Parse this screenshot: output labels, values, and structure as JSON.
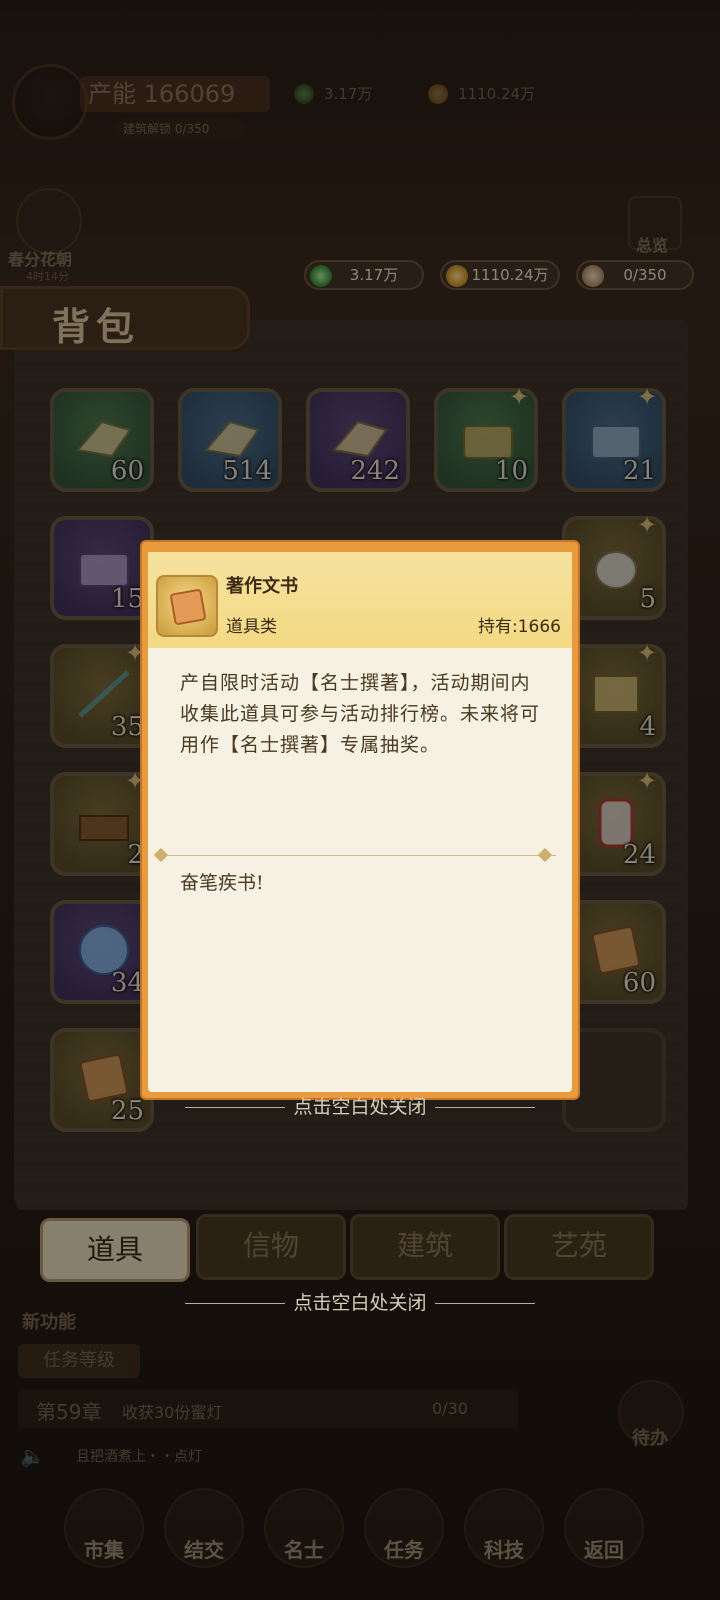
{
  "background_hud": {
    "production_label": "产能",
    "production_value": "166069",
    "production_sub": "建筑解锁 0/350",
    "jade_amount": "3.17万",
    "coin_amount": "1110.24万",
    "left_badge_label": "春分花朝",
    "left_badge_time": "4时14分",
    "right_badge_label": "总览"
  },
  "resources": {
    "jade": "3.17万",
    "coin": "1110.24万",
    "people": "0/350"
  },
  "backpack": {
    "title": "背包",
    "items": [
      {
        "count": "60"
      },
      {
        "count": "514"
      },
      {
        "count": "242"
      },
      {
        "count": "10"
      },
      {
        "count": "21"
      },
      {
        "count": "15"
      },
      {
        "count": "5"
      },
      {
        "count": "35"
      },
      {
        "count": "4"
      },
      {
        "count": "2"
      },
      {
        "count": "24"
      },
      {
        "count": "34"
      },
      {
        "count": "60"
      },
      {
        "count": "25"
      }
    ],
    "tabs": [
      "道具",
      "信物",
      "建筑",
      "艺苑"
    ]
  },
  "lower_hud": {
    "new_feature": "新功能",
    "task_level": "任务等级",
    "chapter": "第59章",
    "chapter_task": "收获30份蜜灯",
    "chapter_progress": "0/30",
    "chat_text": "且把酒煮上・・点灯",
    "pending": "待办",
    "nav": [
      "市集",
      "结交",
      "名士",
      "任务",
      "科技",
      "返回"
    ]
  },
  "popup": {
    "item_name": "著作文书",
    "item_type": "道具类",
    "holding": "持有:1666",
    "description": "产自限时活动【名士撰著】，活动期间内收集此道具可参与活动排行榜。未来将可用作【名士撰著】专属抽奖。",
    "flavor": "奋笔疾书!",
    "close_hint": "点击空白处关闭"
  },
  "colors": {
    "popup_border": "#e79b3c",
    "popup_header": "#f2d983",
    "popup_body": "#f6f1e2"
  }
}
